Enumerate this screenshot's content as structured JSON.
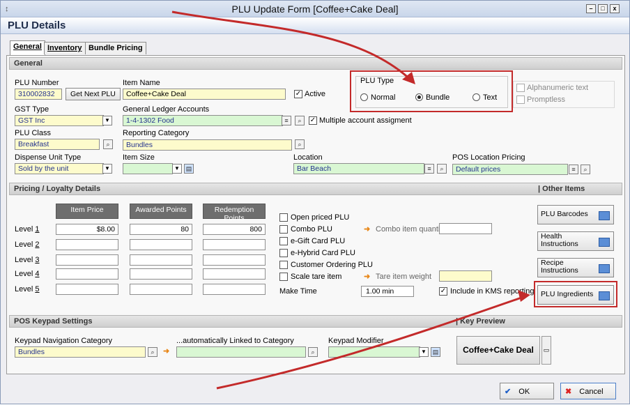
{
  "window": {
    "title": "PLU Update Form [Coffee+Cake Deal]",
    "minimize": "–",
    "maximize": "□",
    "close": "x",
    "sys_icon": "↕"
  },
  "header": {
    "title": "PLU Details"
  },
  "tabs": [
    {
      "label": "General",
      "active": true
    },
    {
      "label": "Inventory"
    },
    {
      "label": "Bundle Pricing"
    }
  ],
  "general": {
    "section_title": "General",
    "plu_number_label": "PLU Number",
    "plu_number": "310002832",
    "get_next_plu": "Get Next PLU",
    "item_name_label": "Item Name",
    "item_name": "Coffee+Cake Deal",
    "active_label": "Active",
    "active": true,
    "plu_type_label": "PLU Type",
    "plu_type_options": [
      "Normal",
      "Bundle",
      "Text"
    ],
    "plu_type_selected": "Bundle",
    "alphanumeric_label": "Alphanumeric text",
    "promptless_label": "Promptless",
    "gst_type_label": "GST Type",
    "gst_type": "GST Inc",
    "gl_accounts_label": "General Ledger Accounts",
    "gl_accounts": "1-4-1302  Food",
    "multiple_account_label": "Multiple account assigment",
    "multiple_account": true,
    "plu_class_label": "PLU Class",
    "plu_class": "Breakfast",
    "reporting_category_label": "Reporting Category",
    "reporting_category": "Bundles",
    "dispense_unit_label": "Dispense Unit Type",
    "dispense_unit": "Sold by the unit",
    "item_size_label": "Item Size",
    "item_size": "",
    "location_label": "Location",
    "location": "Bar Beach",
    "pos_location_pricing_label": "POS Location Pricing",
    "pos_location_pricing": "Default prices"
  },
  "pricing": {
    "section_title": "Pricing / Loyalty Details",
    "columns": [
      "Item Price",
      "Awarded Points",
      "Redemption Points"
    ],
    "levels": [
      {
        "label": "Level 1",
        "key": "1",
        "price": "$8.00",
        "awarded": "80",
        "redemption": "800"
      },
      {
        "label": "Level 2",
        "key": "2",
        "price": "",
        "awarded": "",
        "redemption": ""
      },
      {
        "label": "Level 3",
        "key": "3",
        "price": "",
        "awarded": "",
        "redemption": ""
      },
      {
        "label": "Level 4",
        "key": "4",
        "price": "",
        "awarded": "",
        "redemption": ""
      },
      {
        "label": "Level 5",
        "key": "5",
        "price": "",
        "awarded": "",
        "redemption": ""
      }
    ],
    "options": [
      {
        "label": "Open priced PLU",
        "checked": false
      },
      {
        "label": "Combo PLU",
        "checked": false
      },
      {
        "label": "e-Gift Card PLU",
        "checked": false
      },
      {
        "label": "e-Hybrid Card PLU",
        "checked": false
      },
      {
        "label": "Customer Ordering PLU",
        "checked": false
      },
      {
        "label": "Scale tare item",
        "checked": false
      }
    ],
    "combo_qty_label": "Combo item quantity",
    "combo_qty": "",
    "tare_weight_label": "Tare item weight",
    "tare_weight": "",
    "make_time_label": "Make Time",
    "make_time": "1.00 min",
    "kms_label": "Include in KMS reporting",
    "kms": true
  },
  "other_items": {
    "section_title": "| Other Items",
    "buttons": [
      {
        "label": "PLU Barcodes"
      },
      {
        "label": "Health Instructions"
      },
      {
        "label": "Recipe Instructions"
      },
      {
        "label": "PLU Ingredients"
      }
    ]
  },
  "keypad": {
    "section_title": "POS Keypad Settings",
    "nav_category_label": "Keypad Navigation Category",
    "nav_category": "Bundles",
    "linked_category_label": "...automatically Linked to Category",
    "linked_category": "",
    "modifier_label": "Keypad Modifier",
    "modifier": ""
  },
  "key_preview": {
    "section_title": "| Key Preview",
    "text": "Coffee+Cake Deal"
  },
  "footer": {
    "ok": "OK",
    "cancel": "Cancel"
  },
  "colors": {
    "accent_red": "#c32a2a",
    "field_yellow": "#fdfbcc",
    "field_green": "#d9f7d3"
  }
}
